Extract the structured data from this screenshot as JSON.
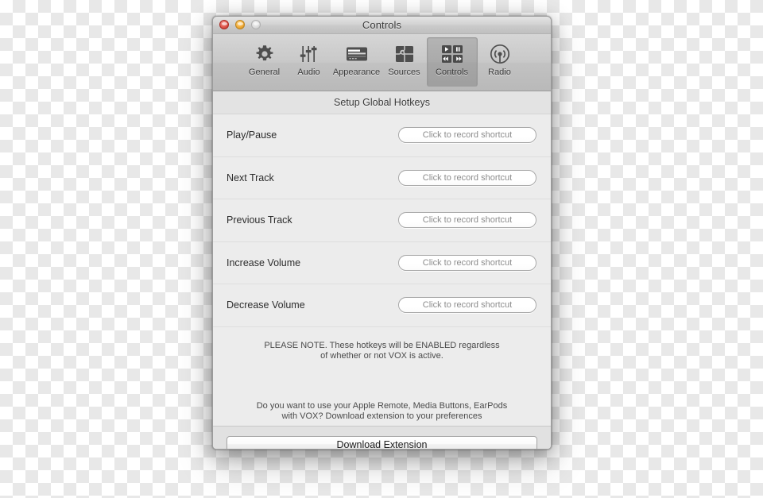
{
  "window": {
    "title": "Controls",
    "traffic_lights": [
      {
        "name": "close",
        "state": "active"
      },
      {
        "name": "minimize",
        "state": "active"
      },
      {
        "name": "zoom",
        "state": "inactive"
      }
    ]
  },
  "toolbar": {
    "items": [
      {
        "label": "General",
        "icon": "gear-icon",
        "selected": false
      },
      {
        "label": "Audio",
        "icon": "sliders-icon",
        "selected": false
      },
      {
        "label": "Appearance",
        "icon": "window-icon",
        "selected": false
      },
      {
        "label": "Sources",
        "icon": "puzzle-icon",
        "selected": false
      },
      {
        "label": "Controls",
        "icon": "transport-icon",
        "selected": true
      },
      {
        "label": "Radio",
        "icon": "broadcast-icon",
        "selected": false
      }
    ]
  },
  "section": {
    "header": "Setup Global Hotkeys"
  },
  "hotkeys": {
    "placeholder": "Click to record shortcut",
    "rows": [
      {
        "label": "Play/Pause",
        "value": "Click to record shortcut"
      },
      {
        "label": "Next Track",
        "value": "Click to record shortcut"
      },
      {
        "label": "Previous Track",
        "value": "Click to record shortcut"
      },
      {
        "label": "Increase Volume",
        "value": "Click to record shortcut"
      },
      {
        "label": "Decrease Volume",
        "value": "Click to record shortcut"
      }
    ]
  },
  "notes": {
    "warning_line1": "PLEASE NOTE. These hotkeys will be ENABLED regardless",
    "warning_line2": "of whether or not VOX is active.",
    "promo_line1": "Do you want to use your Apple Remote, Media Buttons, EarPods",
    "promo_line2": "with VOX? Download extension to your preferences"
  },
  "footer": {
    "download_label": "Download Extension"
  },
  "colors": {
    "window_bg": "#ececec",
    "toolbar_top": "#d6d6d6",
    "toolbar_bottom": "#b9b9b9",
    "section_head_bg": "#e3e3e3",
    "footer_bg": "#e1e1e1",
    "row_divider": "#dedede",
    "close_red": "#e0564b",
    "minimize_yellow": "#f2ad38",
    "zoom_gray": "#dcdcdc",
    "placeholder_text": "#8c8c8c"
  }
}
